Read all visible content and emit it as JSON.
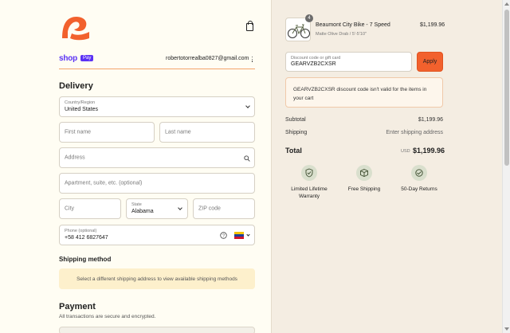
{
  "brand": {
    "accent": "#f2612d",
    "shop_color": "#5a31f4"
  },
  "header": {
    "shop_label": "shop",
    "pay_badge": "Pay",
    "email": "robertotorrealba0827@gmail.com"
  },
  "delivery": {
    "title": "Delivery",
    "country_label": "Country/Region",
    "country_value": "United States",
    "first_name_ph": "First name",
    "last_name_ph": "Last name",
    "address_ph": "Address",
    "apartment_ph": "Apartment, suite, etc. (optional)",
    "city_ph": "City",
    "state_label": "State",
    "state_value": "Alabama",
    "zip_ph": "ZIP code",
    "phone_label": "Phone (optional)",
    "phone_value": "+58 412 6827647"
  },
  "shipping_method": {
    "title": "Shipping method",
    "notice": "Select a different shipping address to view available shipping methods"
  },
  "payment": {
    "title": "Payment",
    "subtitle": "All transactions are secure and encrypted."
  },
  "order": {
    "item": {
      "qty": "4",
      "name": "Beaumont City Bike - 7 Speed",
      "variant": "Matte Olive Drab / 5'-5'10\"",
      "price": "$1,199.96"
    },
    "discount_label": "Discount code or gift card",
    "discount_value": "GEARVZB2CXSR",
    "apply_label": "Apply",
    "error_text": "GEARVZB2CXSR discount code isn't valid for the items in your cart",
    "subtotal_label": "Subtotal",
    "subtotal_value": "$1,199.96",
    "shipping_label": "Shipping",
    "shipping_value": "Enter shipping address",
    "total_label": "Total",
    "currency": "USD",
    "total_value": "$1,199.96"
  },
  "features": [
    {
      "label": "Limited Lifetime Warranty",
      "icon": "warranty-icon"
    },
    {
      "label": "Free Shipping",
      "icon": "box-icon"
    },
    {
      "label": "50-Day Returns",
      "icon": "returns-icon"
    }
  ]
}
